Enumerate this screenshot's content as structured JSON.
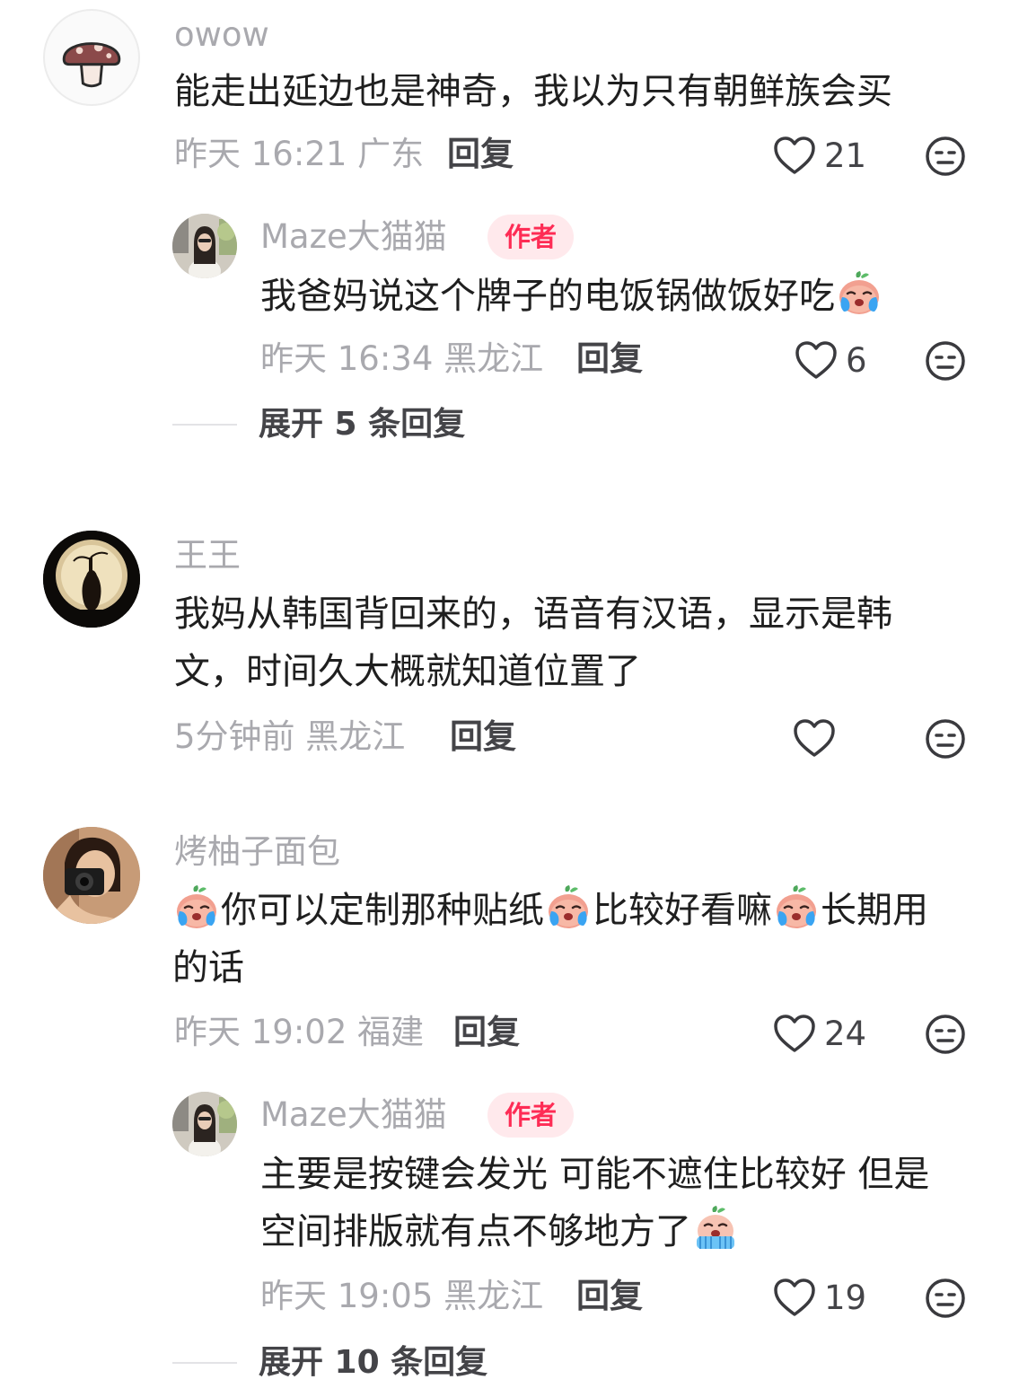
{
  "comments": [
    {
      "username": "owow",
      "avatar": "mushroom-icon",
      "text": "能走出延边也是神奇，我以为只有朝鲜族会买",
      "meta": "昨天 16:21 广东",
      "reply_label": "回复",
      "likes": "21",
      "replies": [
        {
          "username": "Maze大猫猫",
          "badge": "作者",
          "avatar": "woman-photo",
          "text": "我爸妈说这个牌子的电饭锅做饭好吃",
          "emoji": "crying-face-emoji",
          "meta": "昨天 16:34 黑龙江",
          "reply_label": "回复",
          "likes": "6"
        }
      ],
      "expand_label": "展开 5 条回复"
    },
    {
      "username": "王王",
      "avatar": "vase-photo",
      "text": "我妈从韩国背回来的，语音有汉语，显示是韩文，时间久大概就知道位置了",
      "meta": "5分钟前 黑龙江",
      "reply_label": "回复",
      "likes": ""
    },
    {
      "username": "烤柚子面包",
      "avatar": "camera-selfie-photo",
      "text_parts": [
        "你可以定制那种贴纸",
        "比较好看嘛",
        "长期用的话"
      ],
      "emoji": "crying-face-emoji",
      "meta": "昨天 19:02 福建",
      "reply_label": "回复",
      "likes": "24",
      "replies": [
        {
          "username": "Maze大猫猫",
          "badge": "作者",
          "avatar": "woman-photo",
          "text": "主要是按键会发光 可能不遮住比较好 但是空间排版就有点不够地方了",
          "emoji": "sobbing-face-emoji",
          "meta": "昨天 19:05 黑龙江",
          "reply_label": "回复",
          "likes": "19"
        }
      ],
      "expand_label": "展开 10 条回复"
    }
  ],
  "colors": {
    "text": "#1f1f1f",
    "muted": "#a9a9ae",
    "author_badge_bg": "#ffe9ec",
    "author_badge_text": "#fe2c55"
  }
}
